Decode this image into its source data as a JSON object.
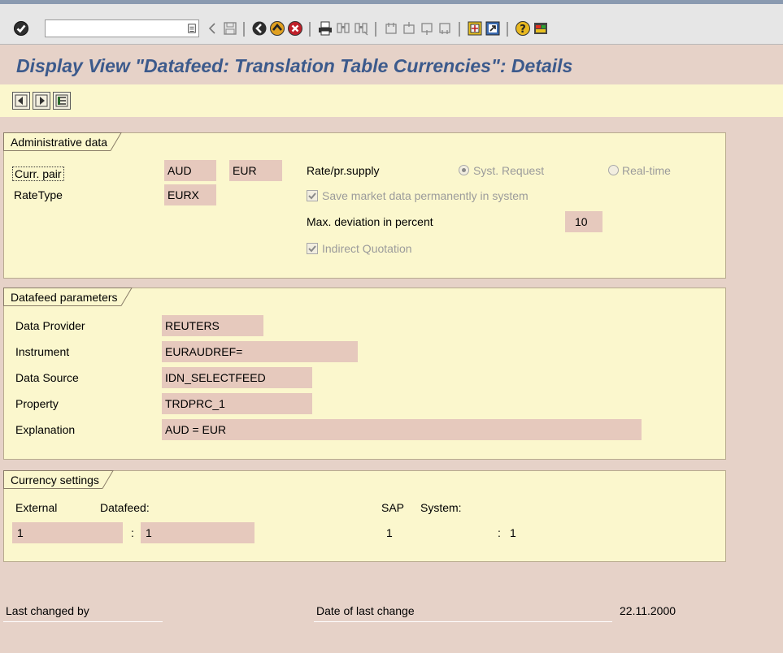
{
  "window": {
    "title": "Display View \"Datafeed: Translation Table Currencies\": Details"
  },
  "toolbar": {
    "command_field_value": "",
    "icons": [
      "enter-icon",
      "back-icon",
      "exit-icon",
      "cancel-icon",
      "print-icon",
      "find-icon",
      "find-next-icon",
      "first-page-icon",
      "previous-page-icon",
      "next-page-icon",
      "last-page-icon",
      "create-session-icon",
      "shortcut-icon",
      "help-icon",
      "customize-layout-icon"
    ]
  },
  "app_toolbar": {
    "icons": [
      "previous-entry-icon",
      "next-entry-icon",
      "variable-list-icon"
    ]
  },
  "admin": {
    "title": "Administrative data",
    "curr_pair_label": "Curr. pair",
    "curr_from": "AUD",
    "curr_to": "EUR",
    "rate_type_label": "RateType",
    "rate_type": "EURX",
    "rate_supply_label": "Rate/pr.supply",
    "radio_syst": "Syst. Request",
    "radio_syst_selected": true,
    "radio_realtime": "Real-time",
    "save_market_label": "Save market data permanently in system",
    "save_market_checked": true,
    "max_dev_label": "Max. deviation in percent",
    "max_dev_value": "10",
    "indirect_label": "Indirect Quotation",
    "indirect_checked": true
  },
  "datafeed": {
    "title": "Datafeed parameters",
    "rows": [
      {
        "label": "Data Provider",
        "value": "REUTERS"
      },
      {
        "label": "Instrument",
        "value": "EURAUDREF="
      },
      {
        "label": "Data Source",
        "value": "IDN_SELECTFEED"
      },
      {
        "label": "Property",
        "value": "TRDPRC_1"
      },
      {
        "label": "Explanation",
        "value": "AUD = EUR"
      }
    ]
  },
  "currency": {
    "title": "Currency settings",
    "external_label": "External",
    "datafeed_label": "Datafeed:",
    "sap_label": "SAP",
    "system_label": "System:",
    "ext_value_1": "1",
    "ext_sep": ":",
    "ext_value_2": "1",
    "sap_value_1": "1",
    "sap_sep": ":",
    "sap_value_2": "1"
  },
  "footer": {
    "last_changed_label": "Last changed by",
    "last_changed_value": "",
    "date_label": "Date of last change",
    "date_value": "22.11.2000"
  }
}
